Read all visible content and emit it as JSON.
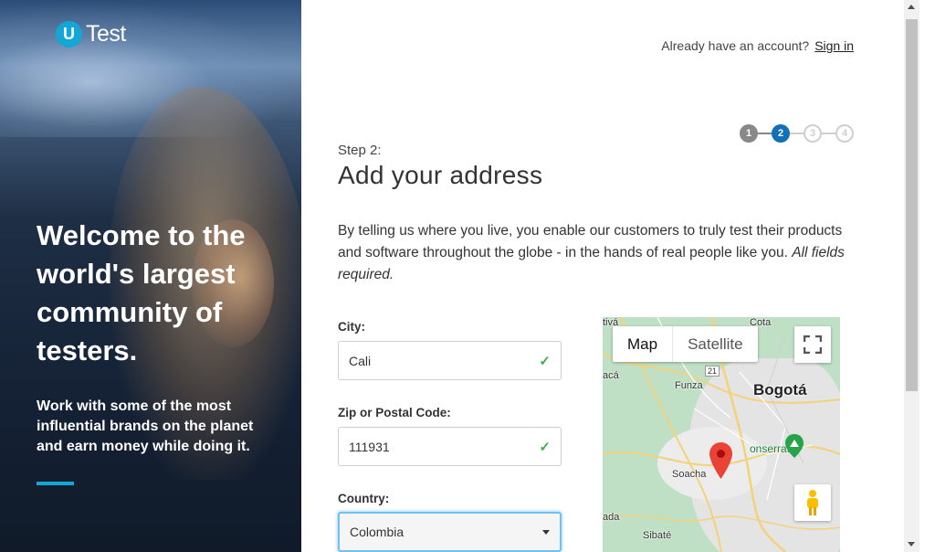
{
  "brand": {
    "logo_letter": "U",
    "logo_text": "Test",
    "accent_color": "#13a7d6"
  },
  "hero": {
    "title": "Welcome to the world's largest community of testers.",
    "subtitle": "Work with some of the most influential brands on the planet and earn money while doing it."
  },
  "header": {
    "account_prompt": "Already have an account?",
    "sign_in_link": "Sign in"
  },
  "stepper": {
    "steps": [
      "1",
      "2",
      "3",
      "4"
    ],
    "current_step": 2,
    "total_steps": 4
  },
  "form": {
    "step_label": "Step 2:",
    "title": "Add your address",
    "intro": "By telling us where you live, you enable our customers to truly test their products and software throughout the globe - in the hands of real people like you.",
    "intro_emphasis": "All fields required.",
    "city": {
      "label": "City:",
      "value": "Cali"
    },
    "zip": {
      "label": "Zip or Postal Code:",
      "value": "111931"
    },
    "country": {
      "label": "Country:",
      "value": "Colombia"
    }
  },
  "map": {
    "tabs": [
      "Map",
      "Satellite"
    ],
    "active_tab": "Map",
    "labels": {
      "city_main": "Bogotá",
      "funza": "Funza",
      "soacha": "Soacha",
      "sibate": "Sibaté",
      "cota": "Cota",
      "monserrate": "onserrate",
      "tiva": "tivá",
      "aca": "acá",
      "ada": "ada",
      "route": "21"
    }
  }
}
